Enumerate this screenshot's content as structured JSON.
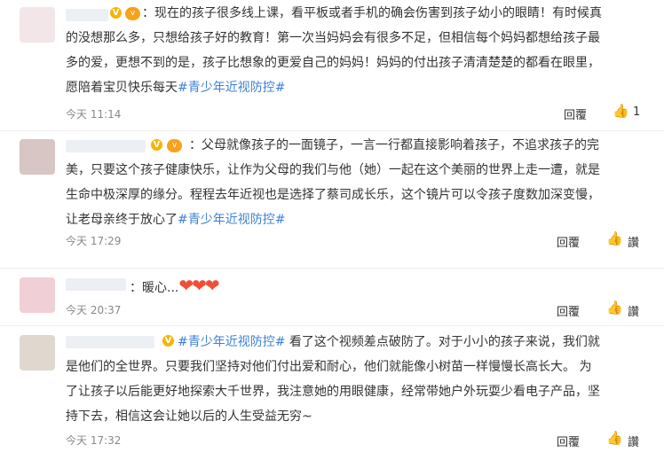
{
  "comments": [
    {
      "text_pre": "：现在的孩子很多线上课，看平板或者手机的确会伤害到孩子幼小的眼睛！有时候真\n的没想那么多，只想给孩子好的教育！第一次当妈妈会有很多不足，但相信每个妈妈都想给孩子最\n多的爱，更想不到的是，孩子比想象的更爱自己的妈妈！妈妈的付出孩子清清楚楚的都看在眼里，\n愿陪着宝贝快乐每天",
      "tag": "#青少年近视防控#",
      "time": "今天 11:14",
      "reply": "回覆",
      "like": "1"
    },
    {
      "text_pre": "：父母就像孩子的一面镜子，一言一行都直接影响着孩子，不追求孩子的完\n美，只要这个孩子健康快乐，让作为父母的我们与他（她）一起在这个美丽的世界上走一遭，就是\n生命中极深厚的缘分。程程去年近视也是选择了蔡司成长乐，这个镜片可以令孩子度数加深变慢，\n让老母亲终于放心了",
      "tag": "#青少年近视防控#",
      "time": "今天 17:29",
      "reply": "回覆",
      "like": "讚"
    },
    {
      "text_pre": "：暖心...",
      "time": "今天 20:37",
      "reply": "回覆",
      "like": "讚"
    },
    {
      "tag": "#青少年近视防控#",
      "text_post": " 看了这个视频差点破防了。对于小小的孩子来说，我们就\n是他们的全世界。只要我们坚持对他们付出爱和耐心，他们就能像小树苗一样慢慢长高长大。 为\n了让孩子以后能更好地探索大千世界，我注意她的用眼健康，经常带她户外玩耍少看电子产品，坚\n持下去，相信这会让她以后的人生受益无穷~",
      "time": "今天 17:32",
      "reply": "回覆",
      "like": "讚"
    }
  ],
  "icons": {
    "vip": "V",
    "level": "v",
    "like_icon": "thumbs-up-icon"
  }
}
